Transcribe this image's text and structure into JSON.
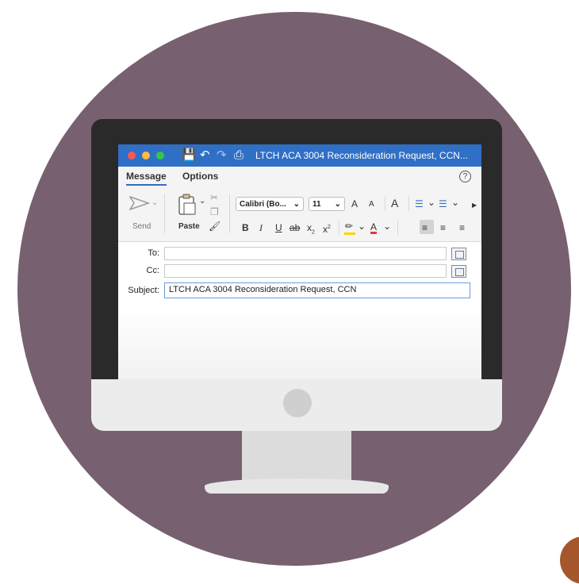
{
  "window": {
    "title": "LTCH ACA 3004 Reconsideration Request, CCN...",
    "traffic_lights": [
      "#fc5753",
      "#fdbc40",
      "#33c748"
    ],
    "title_icons": [
      "save-icon",
      "undo-icon",
      "redo-icon",
      "print-icon"
    ]
  },
  "tabs": [
    {
      "label": "Message",
      "active": true
    },
    {
      "label": "Options",
      "active": false
    }
  ],
  "help_label": "?",
  "ribbon": {
    "send_label": "Send",
    "paste_label": "Paste",
    "font_name": "Calibri (Bo...",
    "font_size": "11",
    "grow_font": "A",
    "shrink_font": "A",
    "clear_format": "A",
    "bold": "B",
    "italic": "I",
    "underline": "U",
    "strikethrough": "ab",
    "subscript": "x",
    "superscript": "x",
    "font_color": "A",
    "highlight_color": "#f5d800",
    "font_color_value": "#e53935"
  },
  "header": {
    "to_label": "To:",
    "cc_label": "Cc:",
    "subject_label": "Subject:",
    "subject_value": "LTCH ACA 3004 Reconsideration Request, CCN"
  },
  "colors": {
    "background_circle": "#776070",
    "accent": "#2f6fc6",
    "corner_shape": "#a5562b"
  }
}
